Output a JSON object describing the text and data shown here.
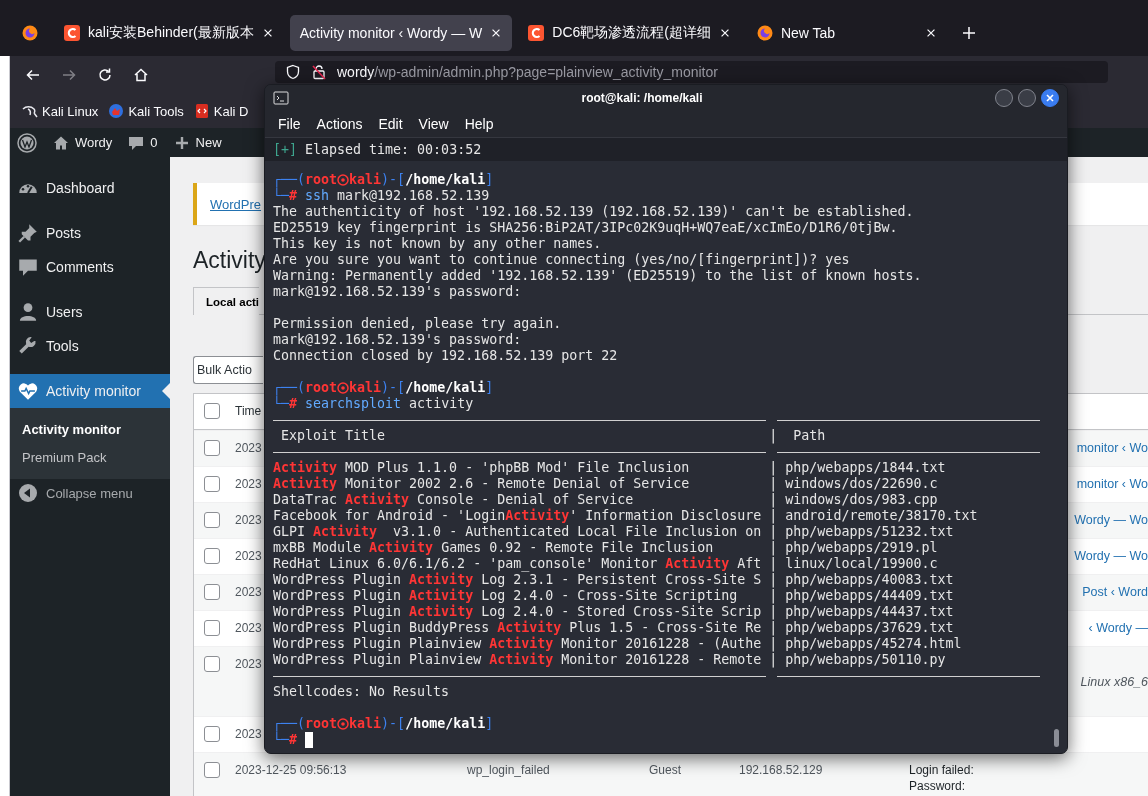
{
  "browser": {
    "tabs": [
      {
        "title": "kali安装Behinder(最新版本",
        "selected": false
      },
      {
        "title": "Activity monitor ‹ Wordy — W",
        "selected": true
      },
      {
        "title": "DC6靶场渗透流程(超详细",
        "selected": false
      },
      {
        "title": "New Tab",
        "selected": false
      }
    ],
    "navigation": {
      "forward_disabled": true,
      "host": "wordy",
      "path": "/wp-admin/admin.php?page=plainview_activity_monitor"
    },
    "bookmarks": [
      {
        "label": "Kali Linux"
      },
      {
        "label": "Kali Tools"
      },
      {
        "label": "Kali D"
      }
    ]
  },
  "admin_bar": {
    "site": "Wordy",
    "comments": "0",
    "new": "New"
  },
  "sidebar": {
    "groups": [
      [
        {
          "label": "Dashboard",
          "selected": false
        }
      ],
      [
        {
          "label": "Posts",
          "selected": false
        },
        {
          "label": "Comments",
          "selected": false
        }
      ],
      [
        {
          "label": "Users",
          "selected": false
        },
        {
          "label": "Tools",
          "selected": false
        }
      ],
      [
        {
          "label": "Activity monitor",
          "selected": true
        }
      ]
    ],
    "submenu": [
      {
        "label": "Activity monitor",
        "selected": true
      },
      {
        "label": "Premium Pack",
        "selected": false
      }
    ],
    "collapse": "Collapse menu"
  },
  "content": {
    "notice_link": "WordPre",
    "heading": "Activity",
    "tabs": [
      {
        "label": "Local acti",
        "selected": true
      }
    ],
    "bulk_actions": "Bulk Actio",
    "table": {
      "header": {
        "checked": false,
        "label": "Time"
      },
      "rows": [
        {
          "kind": "link",
          "checked": false,
          "timestamp": "2023",
          "description": "monitor ‹ Wo"
        },
        {
          "kind": "link",
          "checked": false,
          "timestamp": "2023",
          "description": "monitor ‹ Wo"
        },
        {
          "kind": "link",
          "checked": false,
          "timestamp": "2023",
          "description": "Wordy — Wo"
        },
        {
          "kind": "link",
          "checked": false,
          "timestamp": "2023",
          "description": "Wordy — Wo"
        },
        {
          "kind": "link",
          "checked": false,
          "timestamp": "2023",
          "description": "Post ‹ Word"
        },
        {
          "kind": "link",
          "checked": false,
          "timestamp": "2023",
          "description": "‹ Wordy —"
        },
        {
          "kind": "agent",
          "checked": false,
          "timestamp": "2023",
          "description": "Linux x86_6"
        },
        {
          "kind": "plain",
          "checked": false,
          "timestamp": "2023"
        },
        {
          "kind": "full",
          "checked": false,
          "timestamp": "2023-12-25 09:56:13",
          "hook": "wp_login_failed",
          "user": "Guest",
          "ip": "192.168.52.129",
          "description_lines": [
            "Login failed:",
            "Password:"
          ]
        }
      ]
    }
  },
  "terminal": {
    "title": "root@kali: /home/kali",
    "menu": [
      "File",
      "Actions",
      "Edit",
      "View",
      "Help"
    ],
    "lines": [
      {
        "kind": "status",
        "mark": "[+]",
        "text": "Elapsed time: 00:03:52"
      },
      {
        "kind": "prompt",
        "open": "┌──(",
        "user": "root",
        "host": "kali",
        "mid": ")-[",
        "path": "/home/kali",
        "close": "]",
        "corner": "└─",
        "sign": "#",
        "command": "ssh",
        "args": "mark@192.168.52.139"
      },
      {
        "kind": "output",
        "text": "The authenticity of host '192.168.52.139 (192.168.52.139)' can't be established."
      },
      {
        "kind": "output",
        "text": "ED25519 key fingerprint is SHA256:BiP2AT/3IPc02K9uqH+WQ7eaE/xcImEo/D1R6/0tjBw."
      },
      {
        "kind": "output",
        "text": "This key is not known by any other names."
      },
      {
        "kind": "output",
        "text": "Are you sure you want to continue connecting (yes/no/[fingerprint])? yes"
      },
      {
        "kind": "output",
        "text": "Warning: Permanently added '192.168.52.139' (ED25519) to the list of known hosts."
      },
      {
        "kind": "output",
        "text": "mark@192.168.52.139's password:"
      },
      {
        "kind": "blank"
      },
      {
        "kind": "output",
        "text": "Permission denied, please try again."
      },
      {
        "kind": "output",
        "text": "mark@192.168.52.139's password:"
      },
      {
        "kind": "output",
        "text": "Connection closed by 192.168.52.139 port 22"
      },
      {
        "kind": "blank"
      },
      {
        "kind": "prompt",
        "open": "┌──(",
        "user": "root",
        "host": "kali",
        "mid": ")-[",
        "path": "/home/kali",
        "close": "]",
        "corner": "└─",
        "sign": "#",
        "command": "searchsploit",
        "args": "activity"
      },
      {
        "kind": "rule"
      },
      {
        "kind": "header",
        "title": " Exploit Title",
        "sep": "|",
        "path": " Path"
      },
      {
        "kind": "rule"
      },
      {
        "kind": "result",
        "match": "Activity",
        "post": " MOD Plus 1.1.0 - 'phpBB Mod' File Inclusion",
        "sep": "|",
        "path": "php/webapps/1844.txt"
      },
      {
        "kind": "result",
        "match": "Activity",
        "post": " Monitor 2002 2.6 - Remote Denial of Service",
        "sep": "|",
        "path": "windows/dos/22690.c"
      },
      {
        "kind": "result",
        "pre": "DataTrac ",
        "match": "Activity",
        "post": " Console - Denial of Service",
        "sep": "|",
        "path": "windows/dos/983.cpp"
      },
      {
        "kind": "result",
        "pre": "Facebook for Android - 'Login",
        "match": "Activity",
        "post": "' Information Disclosure",
        "sep": "|",
        "path": "android/remote/38170.txt"
      },
      {
        "kind": "result",
        "pre": "GLPI ",
        "match": "Activity",
        "post": "  v3.1.0 - Authenticated Local File Inclusion on",
        "sep": "|",
        "path": "php/webapps/51232.txt"
      },
      {
        "kind": "result",
        "pre": "mxBB Module ",
        "match": "Activity",
        "post": " Games 0.92 - Remote File Inclusion",
        "sep": "|",
        "path": "php/webapps/2919.pl"
      },
      {
        "kind": "result",
        "pre": "RedHat Linux 6.0/6.1/6.2 - 'pam_console' Monitor ",
        "match": "Activity",
        "post": " Aft",
        "sep": "|",
        "path": "linux/local/19900.c"
      },
      {
        "kind": "result",
        "pre": "WordPress Plugin ",
        "match": "Activity",
        "post": " Log 2.3.1 - Persistent Cross-Site S",
        "sep": "|",
        "path": "php/webapps/40083.txt"
      },
      {
        "kind": "result",
        "pre": "WordPress Plugin ",
        "match": "Activity",
        "post": " Log 2.4.0 - Cross-Site Scripting",
        "sep": "|",
        "path": "php/webapps/44409.txt"
      },
      {
        "kind": "result",
        "pre": "WordPress Plugin ",
        "match": "Activity",
        "post": " Log 2.4.0 - Stored Cross-Site Scrip",
        "sep": "|",
        "path": "php/webapps/44437.txt"
      },
      {
        "kind": "result",
        "pre": "WordPress Plugin BuddyPress ",
        "match": "Activity",
        "post": " Plus 1.5 - Cross-Site Re",
        "sep": "|",
        "path": "php/webapps/37629.txt"
      },
      {
        "kind": "result",
        "pre": "WordPress Plugin Plainview ",
        "match": "Activity",
        "post": " Monitor 20161228 - (Authe",
        "sep": "|",
        "path": "php/webapps/45274.html"
      },
      {
        "kind": "result",
        "pre": "WordPress Plugin Plainview ",
        "match": "Activity",
        "post": " Monitor 20161228 - Remote",
        "sep": "|",
        "path": "php/webapps/50110.py"
      },
      {
        "kind": "rule"
      },
      {
        "kind": "output",
        "text": "Shellcodes: No Results"
      },
      {
        "kind": "blank"
      },
      {
        "kind": "prompt",
        "open": "┌──(",
        "user": "root",
        "host": "kali",
        "mid": ")-[",
        "path": "/home/kali",
        "close": "]",
        "corner": "└─",
        "sign": "#",
        "cursor": true
      }
    ]
  }
}
